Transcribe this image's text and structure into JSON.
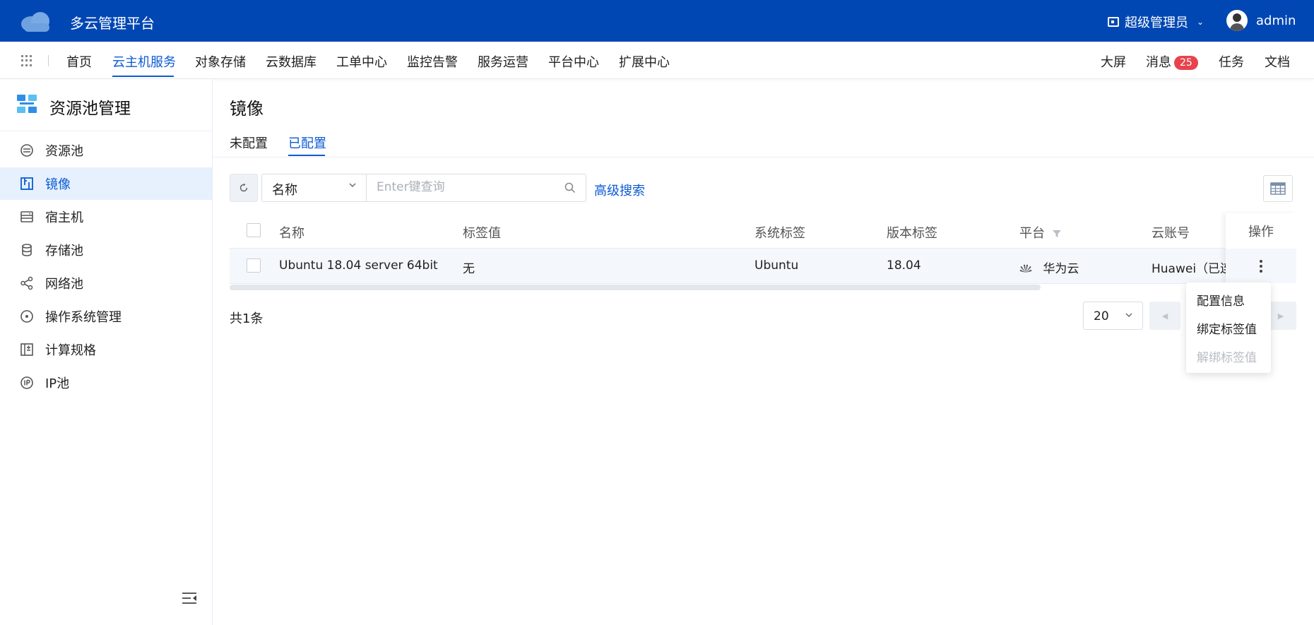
{
  "header": {
    "app_title": "多云管理平台",
    "role": "超级管理员",
    "username": "admin",
    "brand_color": "#0047b3"
  },
  "nav": {
    "items": [
      "首页",
      "云主机服务",
      "对象存储",
      "云数据库",
      "工单中心",
      "监控告警",
      "服务运营",
      "平台中心",
      "扩展中心"
    ],
    "active": "云主机服务",
    "right": {
      "screen": "大屏",
      "messages": "消息",
      "message_count": "25",
      "tasks": "任务",
      "docs": "文档"
    }
  },
  "sidebar": {
    "title": "资源池管理",
    "items": [
      {
        "label": "资源池",
        "icon": "resource-pool-icon"
      },
      {
        "label": "镜像",
        "icon": "image-icon",
        "active": true
      },
      {
        "label": "宿主机",
        "icon": "host-icon"
      },
      {
        "label": "存储池",
        "icon": "database-icon"
      },
      {
        "label": "网络池",
        "icon": "share-network-icon"
      },
      {
        "label": "操作系统管理",
        "icon": "disc-icon"
      },
      {
        "label": "计算规格",
        "icon": "spec-icon"
      },
      {
        "label": "IP池",
        "icon": "ip-icon"
      }
    ]
  },
  "main": {
    "title": "镜像",
    "tabs": [
      "未配置",
      "已配置"
    ],
    "active_tab": "已配置",
    "filter": {
      "field": "名称",
      "placeholder": "Enter键查询",
      "advanced_search": "高级搜索"
    },
    "table": {
      "columns": [
        "名称",
        "标签值",
        "系统标签",
        "版本标签",
        "平台",
        "云账号",
        "操作"
      ],
      "rows": [
        {
          "name": "Ubuntu 18.04 server 64bit",
          "tag_value": "无",
          "system_tag": "Ubuntu",
          "version_tag": "18.04",
          "platform": "华为云",
          "account": "Huawei（已连"
        }
      ]
    },
    "pagination": {
      "total": "共1条",
      "page_size": "20"
    },
    "action_menu": {
      "items": [
        {
          "label": "配置信息",
          "disabled": false
        },
        {
          "label": "绑定标签值",
          "disabled": false
        },
        {
          "label": "解绑标签值",
          "disabled": true
        }
      ]
    }
  }
}
